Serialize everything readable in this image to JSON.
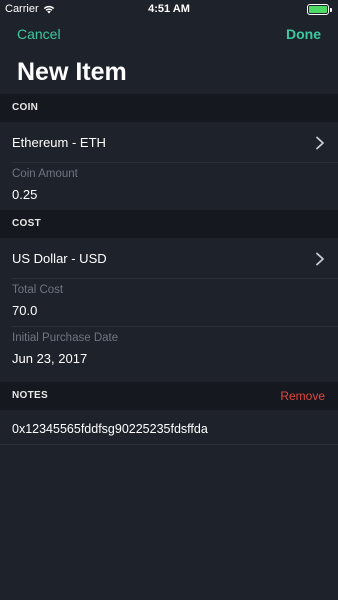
{
  "status_bar": {
    "carrier": "Carrier",
    "time": "4:51 AM",
    "wifi_icon": "wifi-icon",
    "battery_icon": "battery-icon",
    "battery_color": "#4cd964"
  },
  "nav": {
    "cancel_label": "Cancel",
    "done_label": "Done",
    "title": "New Item",
    "accent_color": "#3cc8a0"
  },
  "coin_section": {
    "header": "COIN",
    "coin_value": "Ethereum - ETH",
    "amount_label": "Coin Amount",
    "amount_value": "0.25"
  },
  "cost_section": {
    "header": "COST",
    "currency_value": "US Dollar - USD",
    "total_label": "Total Cost",
    "total_value": "70.0",
    "date_label": "Initial Purchase Date",
    "date_value": "Jun 23, 2017"
  },
  "notes_section": {
    "header": "NOTES",
    "remove_label": "Remove",
    "remove_color": "#e0463d",
    "note_text": "0x12345565fddfsg90225235fdsffda"
  }
}
